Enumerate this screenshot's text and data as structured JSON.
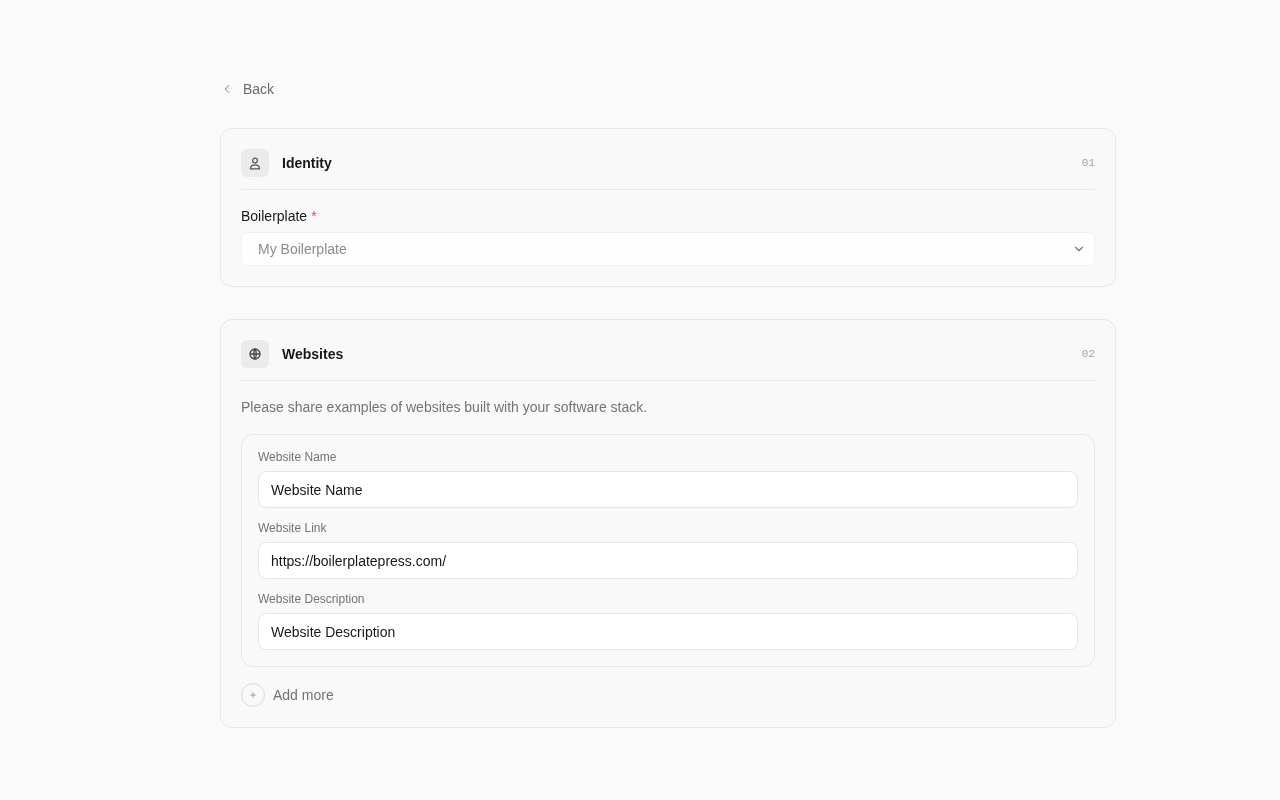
{
  "back": {
    "label": "Back"
  },
  "identity": {
    "title": "Identity",
    "number": "01",
    "field": {
      "label": "Boilerplate",
      "required_mark": "*",
      "placeholder": "My Boilerplate"
    }
  },
  "websites": {
    "title": "Websites",
    "number": "02",
    "description": "Please share examples of websites built with your software stack.",
    "entries": [
      {
        "fields": [
          {
            "label": "Website Name",
            "value": "Website Name"
          },
          {
            "label": "Website Link",
            "value": "https://boilerplatepress.com/"
          },
          {
            "label": "Website Description",
            "value": "Website Description"
          }
        ]
      }
    ],
    "add_button": {
      "label": "Add more"
    }
  }
}
